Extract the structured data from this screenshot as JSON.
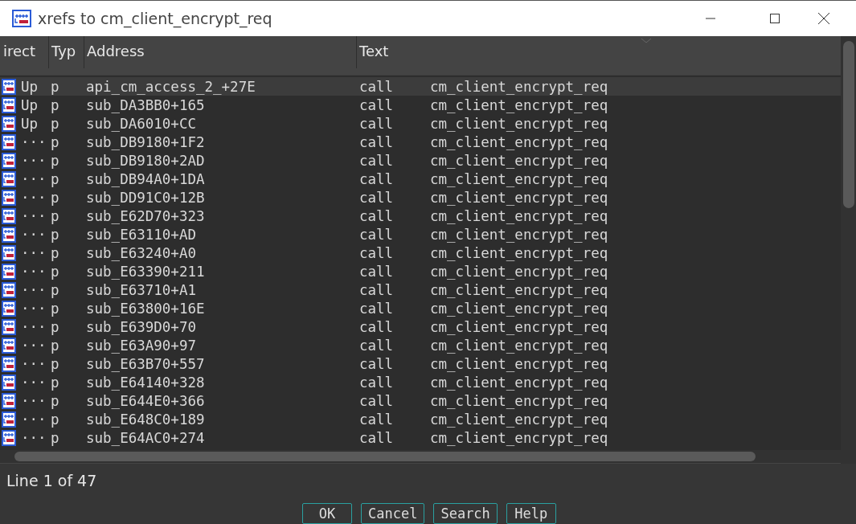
{
  "window": {
    "title": "xrefs to cm_client_encrypt_req"
  },
  "table": {
    "columns": [
      "irect",
      "Typ",
      "Address",
      "Text"
    ],
    "rows": [
      {
        "direction": "Up",
        "type": "p",
        "address": "api_cm_access_2_+27E",
        "instruction": "call",
        "operand": "cm_client_encrypt_req",
        "selected": true
      },
      {
        "direction": "Up",
        "type": "p",
        "address": "sub_DA3BB0+165",
        "instruction": "call",
        "operand": "cm_client_encrypt_req",
        "selected": false
      },
      {
        "direction": "Up",
        "type": "p",
        "address": "sub_DA6010+CC",
        "instruction": "call",
        "operand": "cm_client_encrypt_req",
        "selected": false
      },
      {
        "direction": "···",
        "type": "p",
        "address": "sub_DB9180+1F2",
        "instruction": "call",
        "operand": "cm_client_encrypt_req",
        "selected": false
      },
      {
        "direction": "···",
        "type": "p",
        "address": "sub_DB9180+2AD",
        "instruction": "call",
        "operand": "cm_client_encrypt_req",
        "selected": false
      },
      {
        "direction": "···",
        "type": "p",
        "address": "sub_DB94A0+1DA",
        "instruction": "call",
        "operand": "cm_client_encrypt_req",
        "selected": false
      },
      {
        "direction": "···",
        "type": "p",
        "address": "sub_DD91C0+12B",
        "instruction": "call",
        "operand": "cm_client_encrypt_req",
        "selected": false
      },
      {
        "direction": "···",
        "type": "p",
        "address": "sub_E62D70+323",
        "instruction": "call",
        "operand": "cm_client_encrypt_req",
        "selected": false
      },
      {
        "direction": "···",
        "type": "p",
        "address": "sub_E63110+AD",
        "instruction": "call",
        "operand": "cm_client_encrypt_req",
        "selected": false
      },
      {
        "direction": "···",
        "type": "p",
        "address": "sub_E63240+A0",
        "instruction": "call",
        "operand": "cm_client_encrypt_req",
        "selected": false
      },
      {
        "direction": "···",
        "type": "p",
        "address": "sub_E63390+211",
        "instruction": "call",
        "operand": "cm_client_encrypt_req",
        "selected": false
      },
      {
        "direction": "···",
        "type": "p",
        "address": "sub_E63710+A1",
        "instruction": "call",
        "operand": "cm_client_encrypt_req",
        "selected": false
      },
      {
        "direction": "···",
        "type": "p",
        "address": "sub_E63800+16E",
        "instruction": "call",
        "operand": "cm_client_encrypt_req",
        "selected": false
      },
      {
        "direction": "···",
        "type": "p",
        "address": "sub_E639D0+70",
        "instruction": "call",
        "operand": "cm_client_encrypt_req",
        "selected": false
      },
      {
        "direction": "···",
        "type": "p",
        "address": "sub_E63A90+97",
        "instruction": "call",
        "operand": "cm_client_encrypt_req",
        "selected": false
      },
      {
        "direction": "···",
        "type": "p",
        "address": "sub_E63B70+557",
        "instruction": "call",
        "operand": "cm_client_encrypt_req",
        "selected": false
      },
      {
        "direction": "···",
        "type": "p",
        "address": "sub_E64140+328",
        "instruction": "call",
        "operand": "cm_client_encrypt_req",
        "selected": false
      },
      {
        "direction": "···",
        "type": "p",
        "address": "sub_E644E0+366",
        "instruction": "call",
        "operand": "cm_client_encrypt_req",
        "selected": false
      },
      {
        "direction": "···",
        "type": "p",
        "address": "sub_E648C0+189",
        "instruction": "call",
        "operand": "cm_client_encrypt_req",
        "selected": false
      },
      {
        "direction": "···",
        "type": "p",
        "address": "sub_E64AC0+274",
        "instruction": "call",
        "operand": "cm_client_encrypt_req",
        "selected": false
      }
    ]
  },
  "status_bar": {
    "text": "Line 1 of 47"
  },
  "buttons": [
    "OK",
    "Cancel",
    "Search",
    "Help"
  ]
}
